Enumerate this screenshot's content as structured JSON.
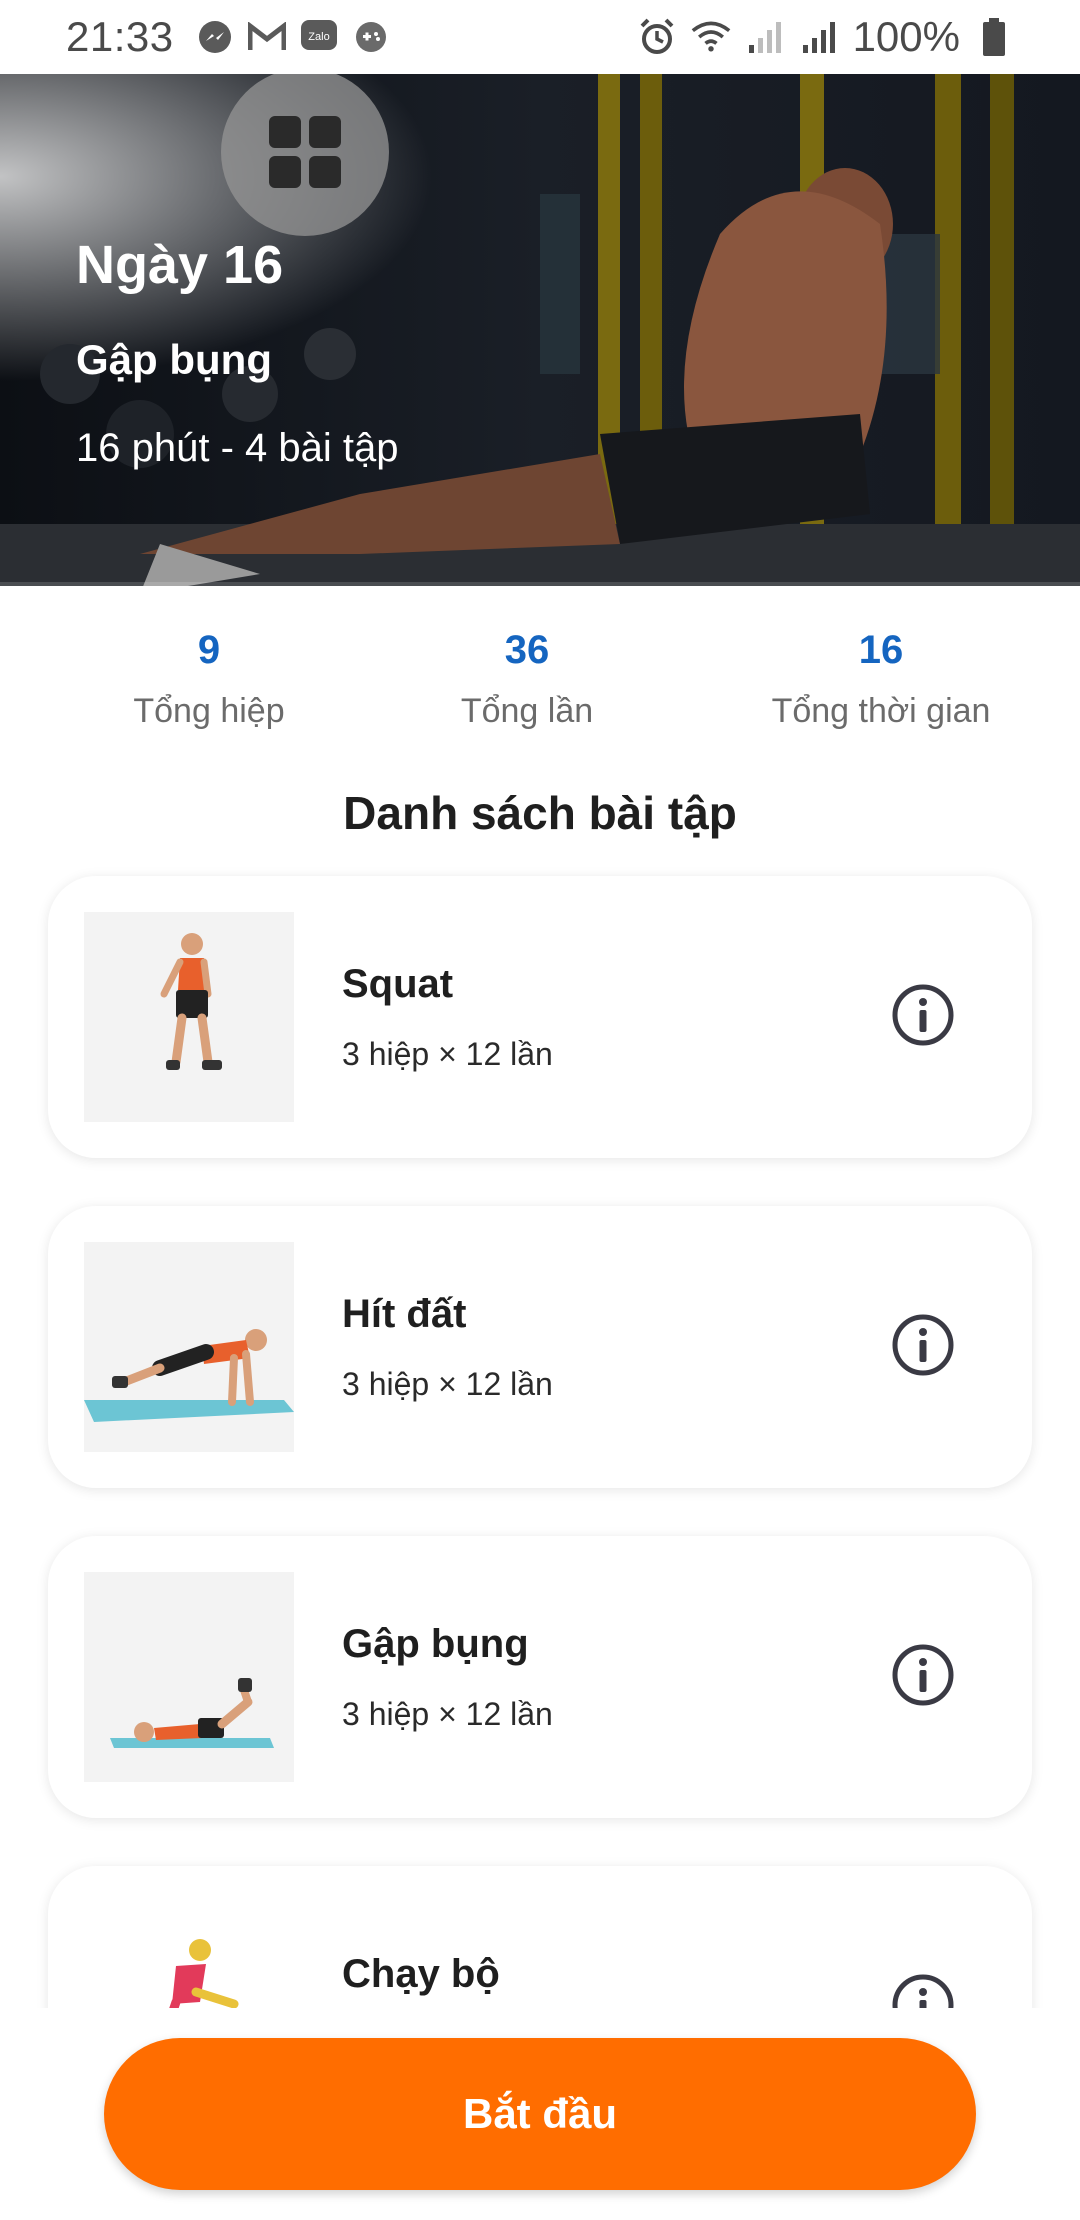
{
  "status_bar": {
    "time": "21:33",
    "battery": "100%",
    "notification_icons": [
      "messenger-icon",
      "gmail-icon",
      "zalo-icon",
      "game-icon"
    ],
    "system_icons": [
      "alarm-icon",
      "wifi-icon",
      "signal-icon",
      "signal-icon",
      "battery-icon"
    ]
  },
  "hero": {
    "title": "Ngày 16",
    "subtitle": "Gập bụng",
    "meta": "16 phút - 4 bài tập"
  },
  "stats": [
    {
      "value": "9",
      "label": "Tổng hiệp"
    },
    {
      "value": "36",
      "label": "Tổng lần"
    },
    {
      "value": "16",
      "label": "Tổng thời gian"
    }
  ],
  "section_title": "Danh sách bài tập",
  "exercises": [
    {
      "name": "Squat",
      "meta": "3 hiệp × 12 lần",
      "icon": "squat-illustration"
    },
    {
      "name": "Hít đất",
      "meta": "3 hiệp × 12 lần",
      "icon": "pushup-illustration"
    },
    {
      "name": "Gập bụng",
      "meta": "3 hiệp × 12 lần",
      "icon": "crunch-illustration"
    },
    {
      "name": "Chạy bộ",
      "meta": "",
      "icon": "running-illustration"
    }
  ],
  "start_button": "Bắt đầu",
  "colors": {
    "accent": "#ff6d00",
    "stat_value": "#1565c0",
    "text": "#1f1f1f"
  }
}
